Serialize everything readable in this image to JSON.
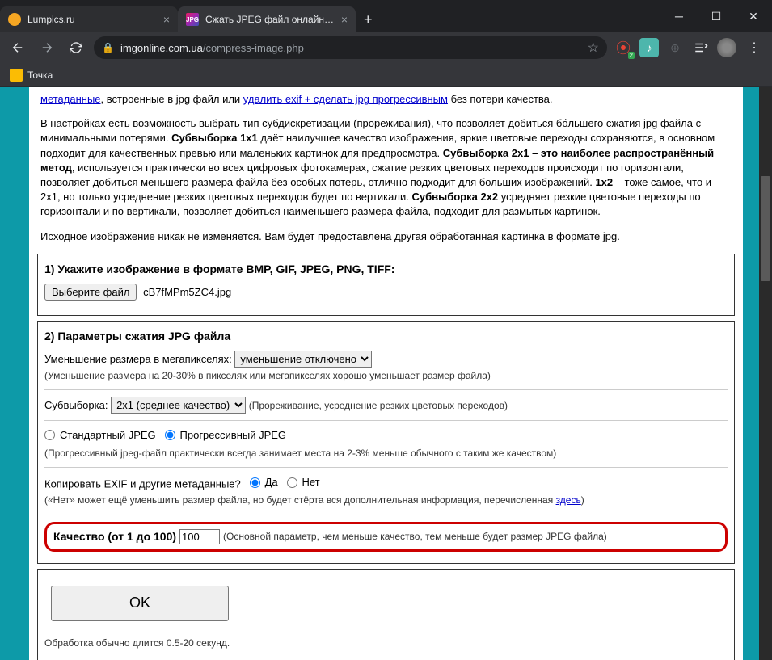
{
  "tabs": [
    {
      "title": "Lumpics.ru",
      "favicon_color": "#f5a623"
    },
    {
      "title": "Сжать JPEG файл онлайн - IMG",
      "favicon_color": "#8e44ad"
    }
  ],
  "url": {
    "domain": "imgonline.com.ua",
    "path": "/compress-image.php"
  },
  "bookmarks": [
    {
      "label": "Точка"
    }
  ],
  "intro": {
    "link1": "метаданные",
    "text1": ", встроенные в jpg файл или ",
    "link2": "удалить exif + сделать jpg прогрессивным",
    "text2": " без потери качества."
  },
  "para2": {
    "t1": "В настройках есть возможность выбрать тип субдискретизации (прореживания), что позволяет добиться бо́льшего сжатия jpg файла с минимальными потерями. ",
    "b1": "Субвыборка 1x1",
    "t2": " даёт наилучшее качество изображения, яркие цветовые переходы сохраняются, в основном подходит для качественных превью или маленьких картинок для предпросмотра. ",
    "b2": "Субвыборка 2x1 – это наиболее распространённый метод",
    "t3": ", используется практически во всех цифровых фотокамерах, сжатие резких цветовых переходов происходит по горизонтали, позволяет добиться меньшего размера файла без особых потерь, отлично подходит для больших изображений. ",
    "b3": "1x2",
    "t4": " – тоже самое, что и 2x1, но только усреднение резких цветовых переходов будет по вертикали. ",
    "b4": "Субвыборка 2x2",
    "t5": " усредняет резкие цветовые переходы по горизонтали и по вертикали, позволяет добиться наименьшего размера файла, подходит для размытых картинок."
  },
  "para3": "Исходное изображение никак не изменяется. Вам будет предоставлена другая обработанная картинка в формате jpg.",
  "section1": {
    "title": "1) Укажите изображение в формате BMP, GIF, JPEG, PNG, TIFF:",
    "button": "Выберите файл",
    "filename": "cB7fMPm5ZC4.jpg"
  },
  "section2": {
    "title": "2) Параметры сжатия JPG файла",
    "megapixel_label": "Уменьшение размера в мегапикселях:",
    "megapixel_value": "уменьшение отключено",
    "megapixel_hint": "(Уменьшение размера на 20-30% в пикселях или мегапикселях хорошо уменьшает размер файла)",
    "subsample_label": "Субвыборка:",
    "subsample_value": "2x1 (среднее качество)",
    "subsample_hint": "(Прореживание, усреднение резких цветовых переходов)",
    "jpeg_std": "Стандартный JPEG",
    "jpeg_prog": "Прогрессивный JPEG",
    "jpeg_hint": "(Прогрессивный jpeg-файл практически всегда занимает места на 2-3% меньше обычного с таким же качеством)",
    "exif_label": "Копировать EXIF и другие метаданные?",
    "exif_yes": "Да",
    "exif_no": "Нет",
    "exif_hint_pre": "(«Нет» может ещё уменьшить размер файла, но будет стёрта вся дополнительная информация, перечисленная ",
    "exif_hint_link": "здесь",
    "exif_hint_post": ")",
    "quality_label": "Качество (от 1 до 100)",
    "quality_value": "100",
    "quality_hint": "(Основной параметр, чем меньше качество, тем меньше будет размер JPEG файла)"
  },
  "section3": {
    "ok": "OK",
    "hint": "Обработка обычно длится 0.5-20 секунд."
  }
}
